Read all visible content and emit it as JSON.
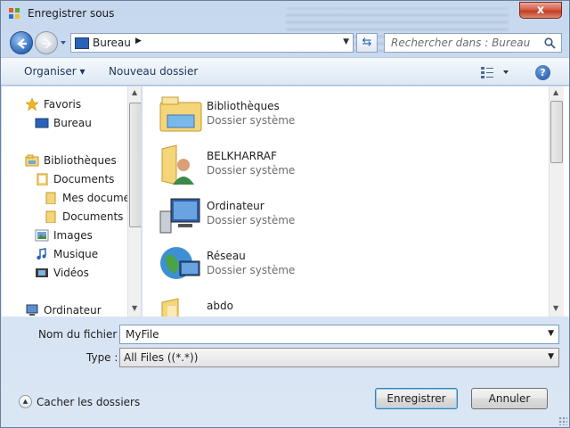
{
  "window": {
    "title": "Enregistrer sous",
    "close_label": "x"
  },
  "address": {
    "location": "Bureau",
    "location_icon": "desktop-icon"
  },
  "search": {
    "placeholder": "Rechercher dans : Bureau"
  },
  "toolbar": {
    "organise_label": "Organiser ▾",
    "new_folder_label": "Nouveau dossier",
    "help_label": "?"
  },
  "nav": {
    "favorites": "Favoris",
    "desktop": "Bureau",
    "libraries": "Bibliothèques",
    "documents": "Documents",
    "my_documents": "Mes documen",
    "public_documents": "Documents p",
    "images": "Images",
    "music": "Musique",
    "videos": "Vidéos",
    "computer": "Ordinateur"
  },
  "files": [
    {
      "name": "Bibliothèques",
      "type": "Dossier système",
      "icon": "libraries-folder-icon"
    },
    {
      "name": "BELKHARRAF",
      "type": "Dossier système",
      "icon": "user-folder-icon"
    },
    {
      "name": "Ordinateur",
      "type": "Dossier système",
      "icon": "computer-icon"
    },
    {
      "name": "Réseau",
      "type": "Dossier système",
      "icon": "network-icon"
    },
    {
      "name": "abdo",
      "type": "",
      "icon": "folder-icon"
    }
  ],
  "form": {
    "filename_label": "Nom du fichier :",
    "filename_value": "MyFile",
    "type_label": "Type :",
    "type_value": "All Files ((*.*))"
  },
  "footer": {
    "hide_folders_label": "Cacher les dossiers",
    "save_label": "Enregistrer",
    "cancel_label": "Annuler"
  },
  "colors": {
    "frame": "#c6d8ee",
    "close_red": "#c33a23",
    "accent": "#3c7fb1"
  }
}
